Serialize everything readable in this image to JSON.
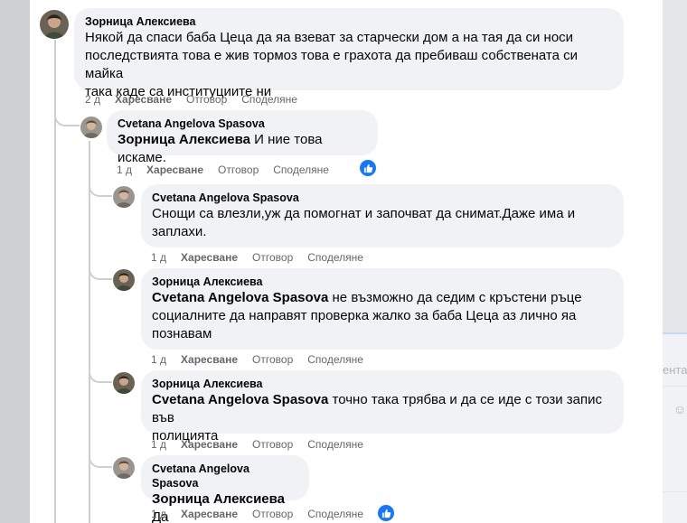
{
  "background": {
    "right_panel_text": "ента"
  },
  "comments": [
    {
      "author": "Зорница Алексиева",
      "lines": [
        "Някой да спаси баба Цеца да яа взеват за старчески дом а на тая да си носи",
        "последствията това е жив тормоз това е грахота да пребиваш собствената си майка",
        "така каде са институциите ни"
      ],
      "time": "2 д",
      "like": "Харесване",
      "reply": "Отговор",
      "share": "Споделяне"
    },
    {
      "author": "Cvetana Angelova Spasova",
      "mention": "Зорница Алексиева",
      "text": " И ние това искаме.",
      "time": "1 д",
      "like": "Харесване",
      "reply": "Отговор",
      "share": "Споделяне",
      "reaction": "like-reaction-icon"
    },
    {
      "author": "Cvetana Angelova Spasova",
      "lines": [
        "Снощи са влезли,уж да помогнат и започват да снимат.Даже има и",
        "заплахи."
      ],
      "time": "1 д",
      "like": "Харесване",
      "reply": "Отговор",
      "share": "Споделяне"
    },
    {
      "author": "Зорница Алексиева",
      "mention": "Cvetana Angelova Spasova",
      "lines": [
        " не възможно да седим с кръстени ръце",
        "социалните да направят проверка жалко за баба Цеца аз лично яа",
        "познавам"
      ],
      "time": "1 д",
      "like": "Харесване",
      "reply": "Отговор",
      "share": "Споделяне"
    },
    {
      "author": "Зорница Алексиева",
      "mention": "Cvetana Angelova Spasova",
      "lines": [
        " точно така трябва и да се иде с този запис във",
        "полицията"
      ],
      "time": "1 д",
      "like": "Харесване",
      "reply": "Отговор",
      "share": "Споделяне"
    },
    {
      "author": "Cvetana Angelova Spasova",
      "mention": "Зорница Алексиева",
      "text": " Да",
      "time": "1 д",
      "like": "Харесване",
      "reply": "Отговор",
      "share": "Споделяне",
      "reaction": "like-reaction-icon"
    }
  ],
  "colors": {
    "bubble": "#f0f2f5",
    "meta": "#65676b",
    "reaction": "#1877f2"
  }
}
